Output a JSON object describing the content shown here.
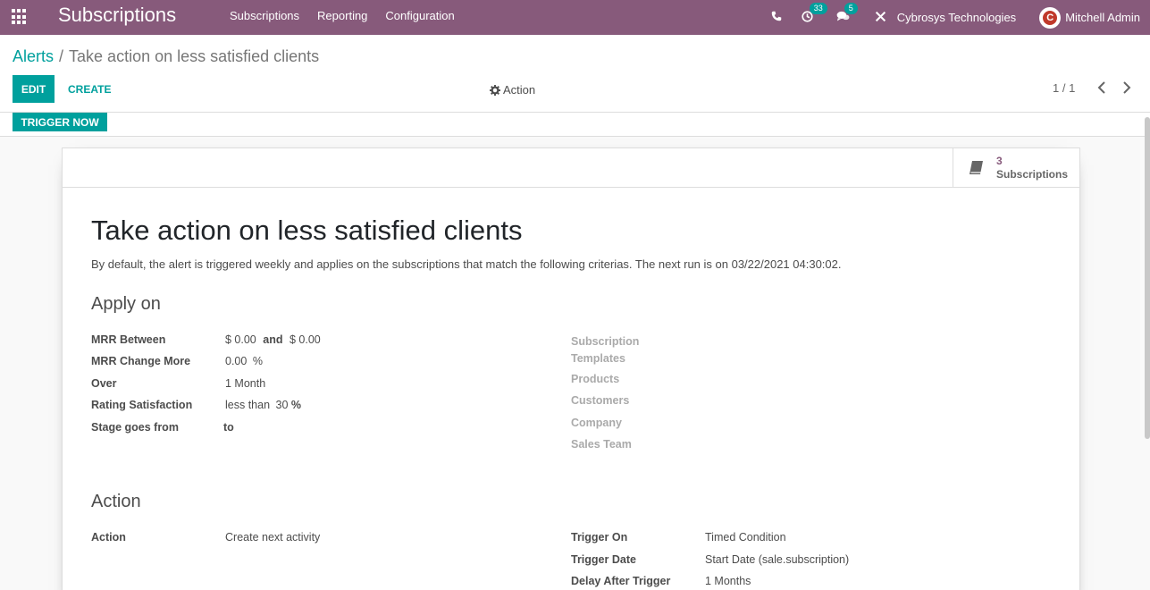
{
  "nav": {
    "app_name": "Subscriptions",
    "menu": [
      "Subscriptions",
      "Reporting",
      "Configuration"
    ],
    "activity_count": "33",
    "message_count": "5",
    "company": "Cybrosys Technologies",
    "user": "Mitchell Admin",
    "avatar_letter": "C"
  },
  "breadcrumb": {
    "parent": "Alerts",
    "separator": "/",
    "current": "Take action on less satisfied clients"
  },
  "toolbar": {
    "edit_label": "EDIT",
    "create_label": "CREATE",
    "action_label": "Action",
    "pager": "1 / 1"
  },
  "status": {
    "trigger_label": "TRIGGER NOW"
  },
  "smart_button": {
    "count": "3",
    "label": "Subscriptions"
  },
  "record": {
    "title": "Take action on less satisfied clients",
    "description": "By default, the alert is triggered weekly and applies on the subscriptions that match the following criterias. The next run is on 03/22/2021 04:30:02.",
    "apply_on_heading": "Apply on",
    "action_heading": "Action",
    "fields_left": {
      "mrr_between_label": "MRR Between",
      "mrr_min": "$ 0.00",
      "mrr_and": "and",
      "mrr_max": "$ 0.00",
      "mrr_change_label": "MRR Change More",
      "mrr_change_value": "0.00",
      "mrr_change_unit": "%",
      "over_label": "Over",
      "over_value": "1 Month",
      "rating_label": "Rating Satisfaction",
      "rating_operator": "less than",
      "rating_value": "30",
      "rating_unit": "%",
      "stage_label": "Stage goes from",
      "stage_to": "to"
    },
    "fields_right": {
      "templates_label_1": "Subscription",
      "templates_label_2": "Templates",
      "products_label": "Products",
      "customers_label": "Customers",
      "company_label": "Company",
      "sales_team_label": "Sales Team"
    },
    "action_fields": {
      "action_label": "Action",
      "action_value": "Create next activity",
      "trigger_on_label": "Trigger On",
      "trigger_on_value": "Timed Condition",
      "trigger_date_label": "Trigger Date",
      "trigger_date_value": "Start Date (sale.subscription)",
      "delay_label": "Delay After Trigger",
      "delay_value": "1 Months"
    }
  },
  "icons": {
    "apps": "apps-grid-icon",
    "phone": "phone-icon",
    "activity": "clock-icon",
    "messages": "chat-icon",
    "settings": "tools-icon",
    "action": "gear-icon",
    "smart_button": "book-icon"
  },
  "colors": {
    "brand": "#875a7b",
    "accent": "#00a09d"
  }
}
